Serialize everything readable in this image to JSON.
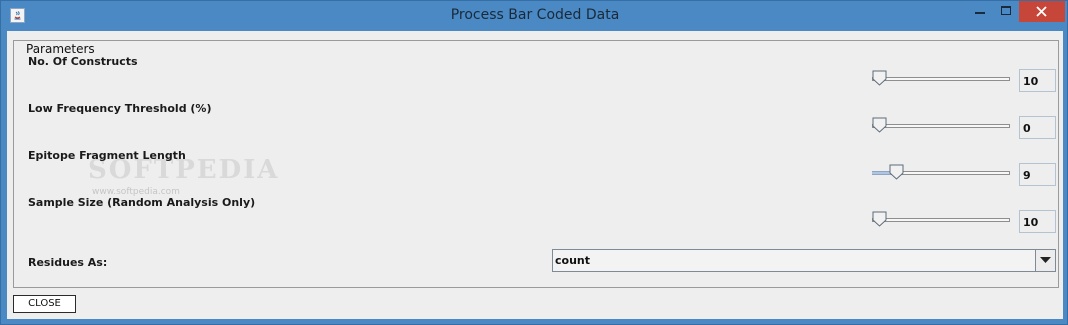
{
  "window": {
    "title": "Process  Bar Coded Data",
    "icon": "java-app-icon"
  },
  "panel": {
    "group_title": "Parameters",
    "sliders": [
      {
        "label": "No. Of Constructs",
        "value": "10",
        "position": 0.0
      },
      {
        "label": "Low Frequency Threshold (%)",
        "value": "0",
        "position": 0.0
      },
      {
        "label": "Epitope Fragment Length",
        "value": "9",
        "position": 0.14
      },
      {
        "label": "Sample Size (Random Analysis Only)",
        "value": "10",
        "position": 0.0
      }
    ],
    "residues": {
      "label": "Residues As:",
      "selected": "count"
    }
  },
  "footer": {
    "close_label": "CLOSE"
  },
  "watermark": {
    "text": "SOFTPEDIA",
    "sub": "www.softpedia.com"
  },
  "colors": {
    "titlebar": "#4a89c4",
    "close_button": "#c7463a",
    "client_bg": "#eeeeee",
    "slider_fill": "#aec6e3"
  }
}
